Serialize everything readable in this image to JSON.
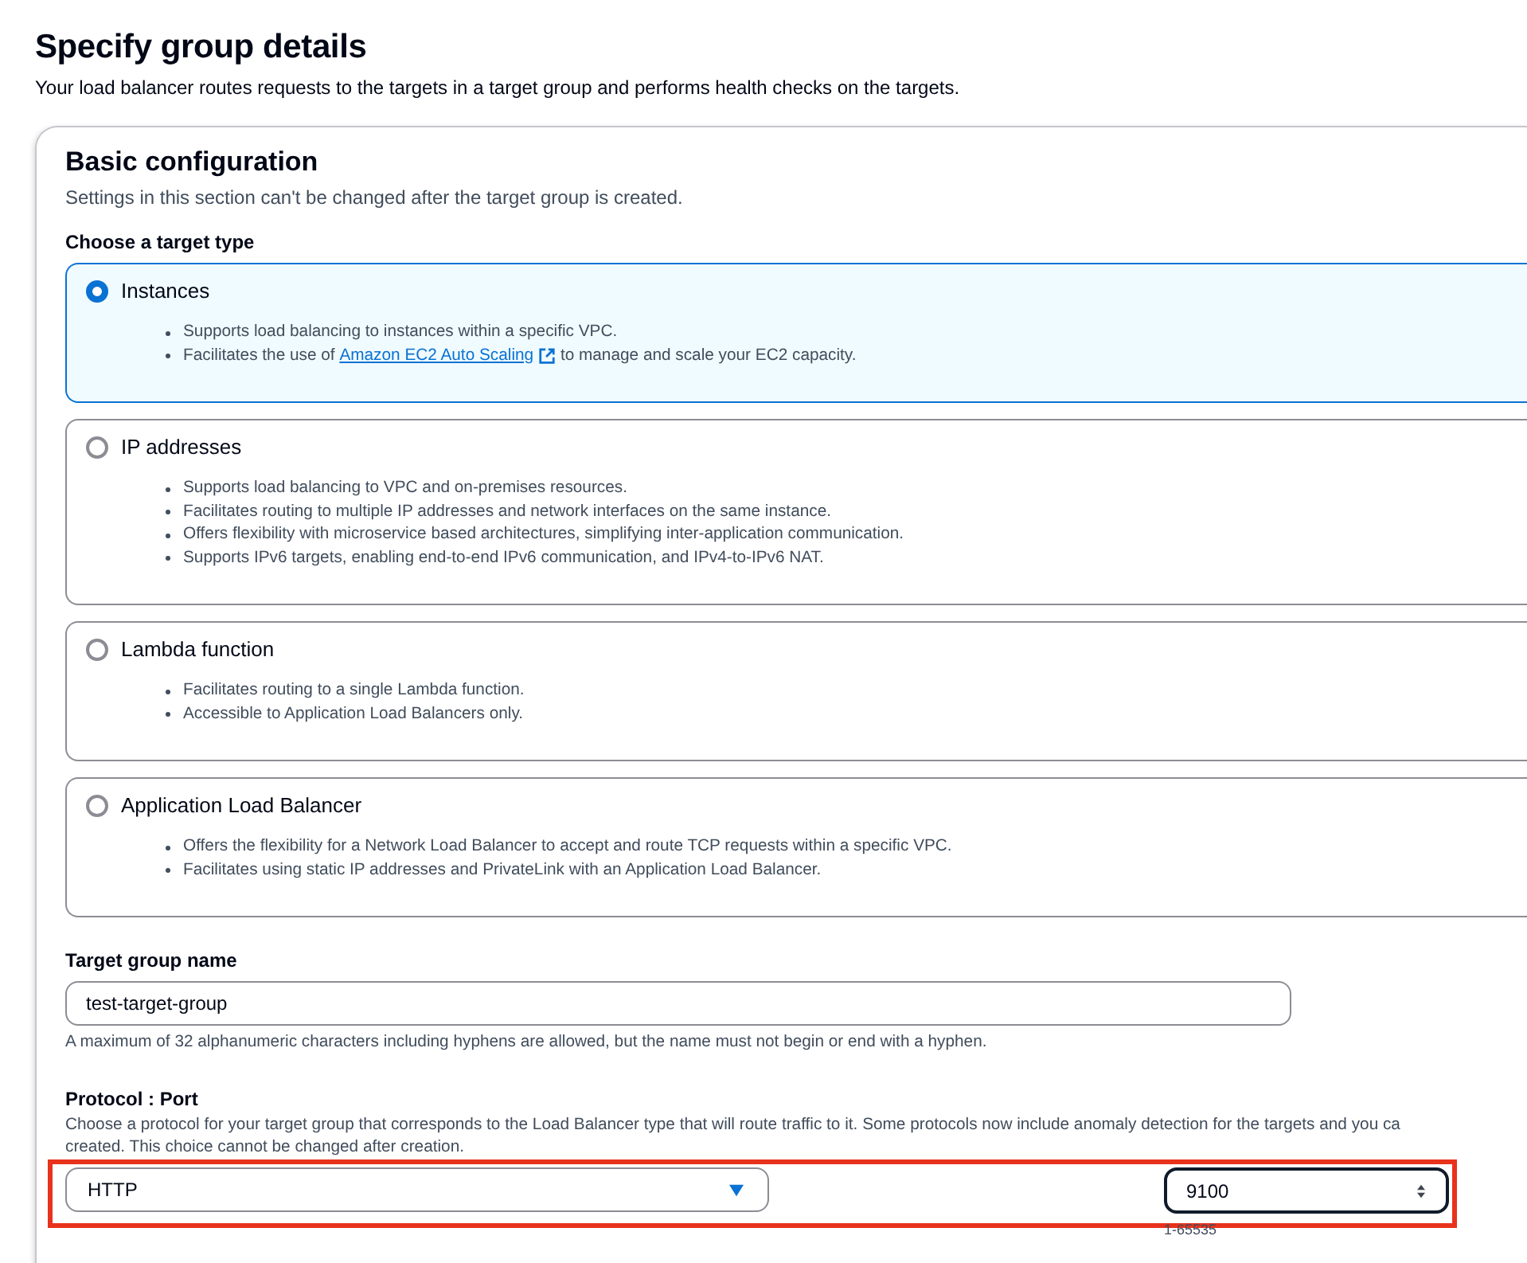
{
  "page": {
    "title": "Specify group details",
    "description": "Your load balancer routes requests to the targets in a target group and performs health checks on the targets."
  },
  "panel": {
    "title": "Basic configuration",
    "description": "Settings in this section can't be changed after the target group is created."
  },
  "target_type": {
    "label": "Choose a target type",
    "options": [
      {
        "label": "Instances",
        "selected": true,
        "bullets": [
          "Supports load balancing to instances within a specific VPC.",
          {
            "before": "Facilitates the use of ",
            "link": "Amazon EC2 Auto Scaling",
            "after": " to manage and scale your EC2 capacity."
          }
        ]
      },
      {
        "label": "IP addresses",
        "selected": false,
        "bullets": [
          "Supports load balancing to VPC and on-premises resources.",
          "Facilitates routing to multiple IP addresses and network interfaces on the same instance.",
          "Offers flexibility with microservice based architectures, simplifying inter-application communication.",
          "Supports IPv6 targets, enabling end-to-end IPv6 communication, and IPv4-to-IPv6 NAT."
        ]
      },
      {
        "label": "Lambda function",
        "selected": false,
        "bullets": [
          "Facilitates routing to a single Lambda function.",
          "Accessible to Application Load Balancers only."
        ]
      },
      {
        "label": "Application Load Balancer",
        "selected": false,
        "bullets": [
          "Offers the flexibility for a Network Load Balancer to accept and route TCP requests within a specific VPC.",
          "Facilitates using static IP addresses and PrivateLink with an Application Load Balancer."
        ]
      }
    ]
  },
  "target_group_name": {
    "label": "Target group name",
    "value": "test-target-group",
    "hint": "A maximum of 32 alphanumeric characters including hyphens are allowed, but the name must not begin or end with a hyphen."
  },
  "protocol_port": {
    "label": "Protocol : Port",
    "description_lines": [
      "Choose a protocol for your target group that corresponds to the Load Balancer type that will route traffic to it. Some protocols now include anomaly detection for the targets and you ca",
      "created. This choice cannot be changed after creation."
    ],
    "protocol": "HTTP",
    "port": "9100",
    "port_hint": "1-65535"
  }
}
